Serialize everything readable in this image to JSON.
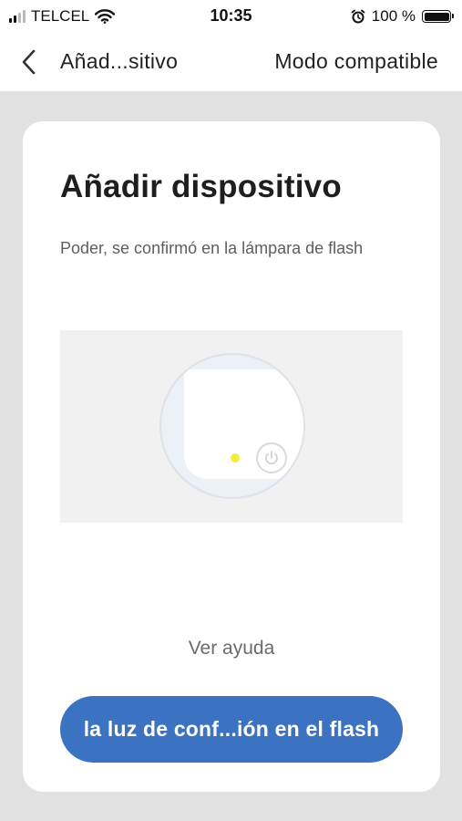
{
  "status_bar": {
    "carrier": "TELCEL",
    "time": "10:35",
    "battery_percent": "100 %",
    "icons": [
      "signal-icon",
      "wifi-icon",
      "alarm-icon",
      "battery-icon"
    ]
  },
  "nav": {
    "back_icon": "chevron-left-icon",
    "title": "Añad...sitivo",
    "action_label": "Modo compatible"
  },
  "card": {
    "title": "Añadir dispositivo",
    "description": "Poder, se confirmó en la lámpara de flash",
    "illustration": {
      "led_color": "#f4ec3a",
      "icon": "power-icon"
    },
    "help_link": "Ver ayuda",
    "primary_button": "la luz de conf...ión en el flash"
  },
  "colors": {
    "background": "#e1e1e1",
    "card": "#ffffff",
    "accent": "#3c72c2"
  }
}
